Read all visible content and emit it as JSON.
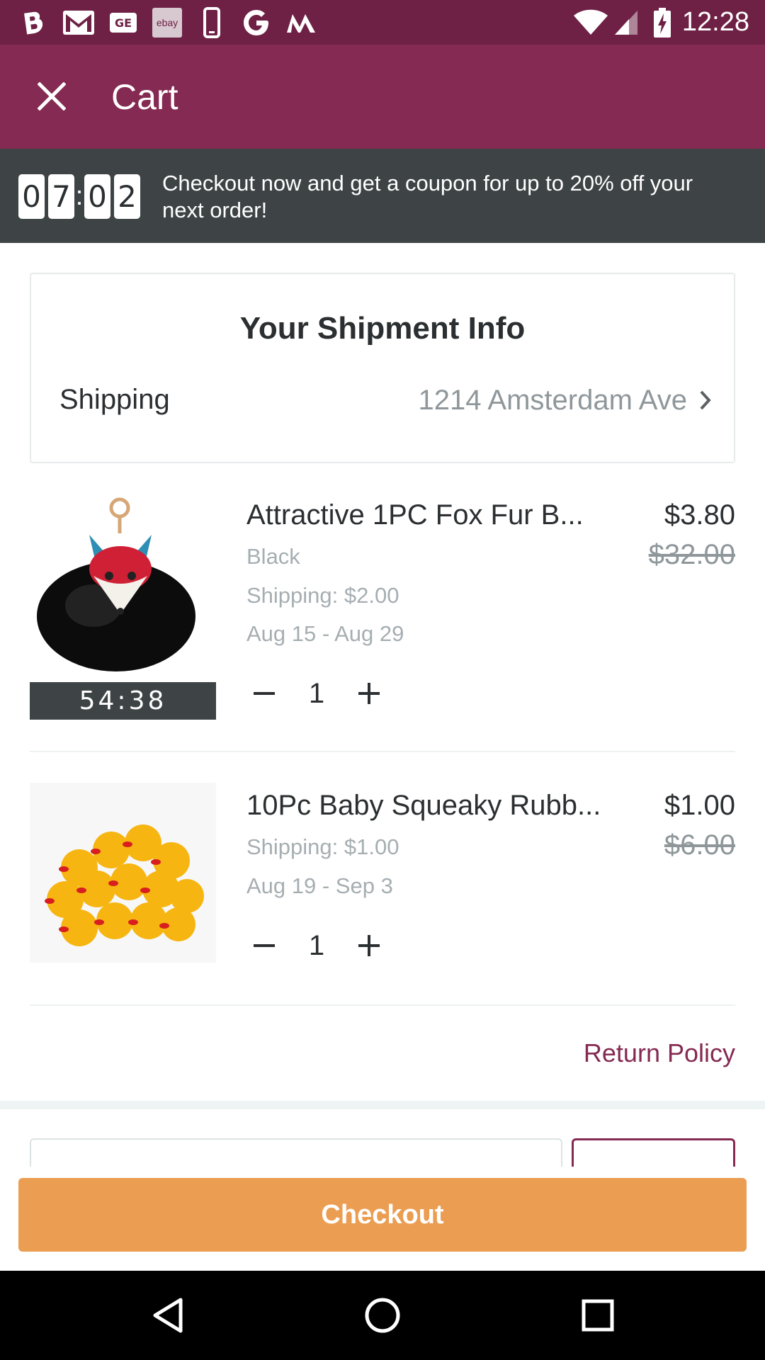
{
  "status_bar": {
    "time": "12:28",
    "icons": [
      "b-app-icon",
      "gmail-icon",
      "ge-app-icon",
      "ebay-icon",
      "phone-icon",
      "google-icon",
      "m-app-icon",
      "wifi-icon",
      "signal-icon",
      "battery-charging-icon"
    ],
    "ebay_label": "ebay"
  },
  "app_bar": {
    "title": "Cart",
    "close_icon": "close-icon"
  },
  "banner": {
    "timer_digits": [
      "0",
      "7",
      "0",
      "2"
    ],
    "separator": ":",
    "message": "Checkout now and get a coupon for up to 20% off your next order!"
  },
  "shipment": {
    "title": "Your Shipment Info",
    "label": "Shipping",
    "address": "1214 Amsterdam Ave"
  },
  "items": [
    {
      "name": "Attractive 1PC Fox Fur B...",
      "price": "$3.80",
      "original_price": "$32.00",
      "color": "Black",
      "shipping": "Shipping: $2.00",
      "delivery": "Aug 15 - Aug 29",
      "quantity": "1",
      "timer": "54:38"
    },
    {
      "name": "10Pc Baby Squeaky Rubb...",
      "price": "$1.00",
      "original_price": "$6.00",
      "shipping": "Shipping: $1.00",
      "delivery": "Aug 19 - Sep 3",
      "quantity": "1"
    }
  ],
  "return_policy": "Return Policy",
  "checkout": {
    "label": "Checkout"
  },
  "colors": {
    "status_bar": "#6e2145",
    "app_bar": "#852a52",
    "banner": "#3e4446",
    "checkout": "#eb9d51",
    "accent_text": "#852a52"
  },
  "nav": [
    "back-icon",
    "home-icon",
    "recents-icon"
  ]
}
